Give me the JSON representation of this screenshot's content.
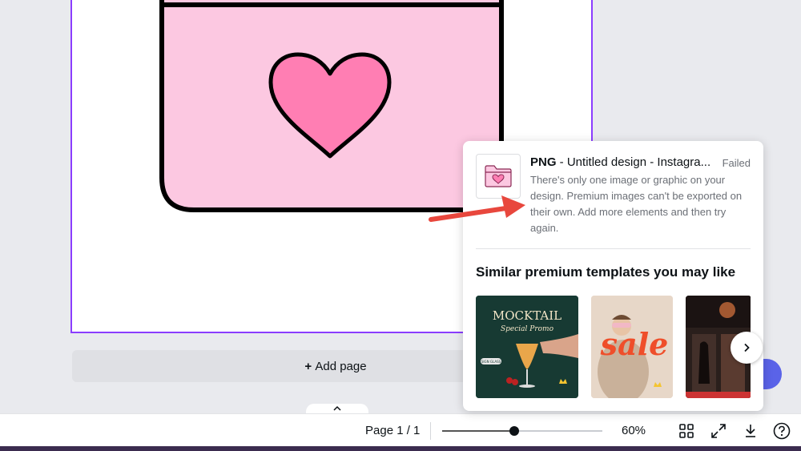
{
  "canvas": {
    "add_page_label": "Add page"
  },
  "bottom_bar": {
    "page_count": "Page 1 / 1",
    "zoom_level": "60%",
    "zoom_fraction": 0.45
  },
  "export_popup": {
    "format": "PNG",
    "title_rest": " - Untitled design - Instagra...",
    "status": "Failed",
    "message": "There's only one image or graphic on your design. Premium images can't be exported on their own. Add more elements and then try again.",
    "similar_heading": "Similar premium templates you may like",
    "templates": [
      {
        "name": "mocktail-template",
        "line1": "MOCKTAIL",
        "line2": "Special Promo",
        "tag": "SIGN GLASS"
      },
      {
        "name": "sale-template",
        "line1": "sale"
      },
      {
        "name": "photo-template"
      }
    ]
  },
  "icons": {
    "grid": "grid-view-icon",
    "fullscreen": "fullscreen-icon",
    "download": "download-icon",
    "help": "help-icon",
    "chevron_up": "chevron-up-icon",
    "chevron_right": "chevron-right-icon"
  },
  "colors": {
    "accent": "#8b3dff",
    "folder_pink": "#fcc8e1",
    "heart_pink": "#ff7eb3",
    "arrow_red": "#e8473d"
  }
}
